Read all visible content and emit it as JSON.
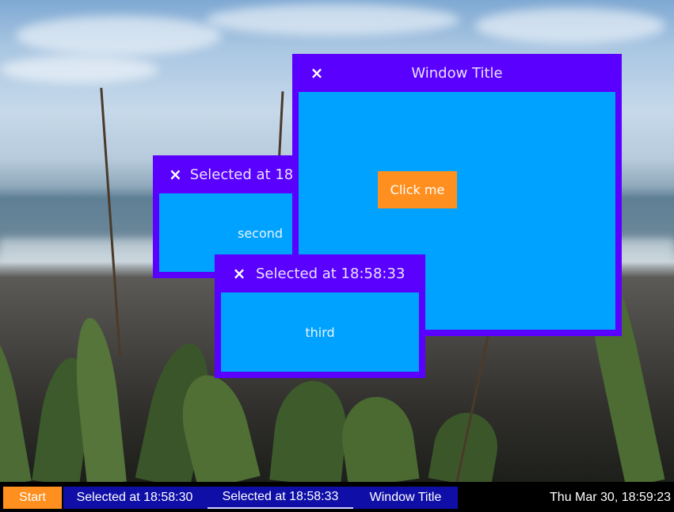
{
  "colors": {
    "window_frame": "#5a00ff",
    "window_content": "#00a2ff",
    "accent_orange": "#ff8f1f",
    "taskbar_bg": "#000000",
    "taskbar_tasks_bg": "#0f0fa8"
  },
  "windows": {
    "main": {
      "title": "Window Title",
      "close_icon": "×",
      "button_label": "Click me"
    },
    "second": {
      "title": "Selected at 18:58:30",
      "close_icon": "×",
      "content_text": "second"
    },
    "third": {
      "title": "Selected at 18:58:33",
      "close_icon": "×",
      "content_text": "third"
    }
  },
  "taskbar": {
    "start_label": "Start",
    "tasks": [
      {
        "label": "Selected at 18:58:30",
        "active": false
      },
      {
        "label": "Selected at 18:58:33",
        "active": true
      },
      {
        "label": "Window Title",
        "active": false
      }
    ],
    "clock": "Thu Mar 30, 18:59:23"
  }
}
